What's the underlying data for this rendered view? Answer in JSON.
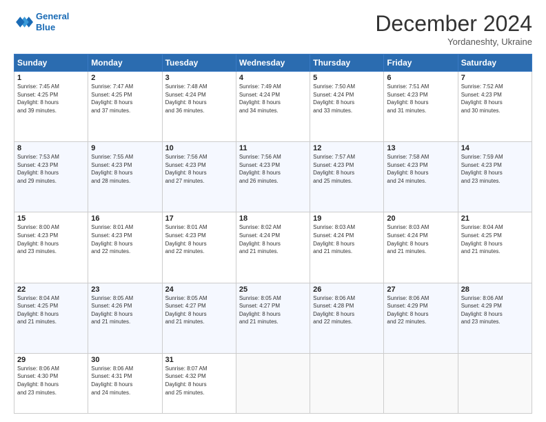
{
  "header": {
    "logo_line1": "General",
    "logo_line2": "Blue",
    "month_title": "December 2024",
    "location": "Yordaneshty, Ukraine"
  },
  "weekdays": [
    "Sunday",
    "Monday",
    "Tuesday",
    "Wednesday",
    "Thursday",
    "Friday",
    "Saturday"
  ],
  "weeks": [
    [
      {
        "day": "1",
        "lines": [
          "Sunrise: 7:45 AM",
          "Sunset: 4:25 PM",
          "Daylight: 8 hours",
          "and 39 minutes."
        ]
      },
      {
        "day": "2",
        "lines": [
          "Sunrise: 7:47 AM",
          "Sunset: 4:25 PM",
          "Daylight: 8 hours",
          "and 37 minutes."
        ]
      },
      {
        "day": "3",
        "lines": [
          "Sunrise: 7:48 AM",
          "Sunset: 4:24 PM",
          "Daylight: 8 hours",
          "and 36 minutes."
        ]
      },
      {
        "day": "4",
        "lines": [
          "Sunrise: 7:49 AM",
          "Sunset: 4:24 PM",
          "Daylight: 8 hours",
          "and 34 minutes."
        ]
      },
      {
        "day": "5",
        "lines": [
          "Sunrise: 7:50 AM",
          "Sunset: 4:24 PM",
          "Daylight: 8 hours",
          "and 33 minutes."
        ]
      },
      {
        "day": "6",
        "lines": [
          "Sunrise: 7:51 AM",
          "Sunset: 4:23 PM",
          "Daylight: 8 hours",
          "and 31 minutes."
        ]
      },
      {
        "day": "7",
        "lines": [
          "Sunrise: 7:52 AM",
          "Sunset: 4:23 PM",
          "Daylight: 8 hours",
          "and 30 minutes."
        ]
      }
    ],
    [
      {
        "day": "8",
        "lines": [
          "Sunrise: 7:53 AM",
          "Sunset: 4:23 PM",
          "Daylight: 8 hours",
          "and 29 minutes."
        ]
      },
      {
        "day": "9",
        "lines": [
          "Sunrise: 7:55 AM",
          "Sunset: 4:23 PM",
          "Daylight: 8 hours",
          "and 28 minutes."
        ]
      },
      {
        "day": "10",
        "lines": [
          "Sunrise: 7:56 AM",
          "Sunset: 4:23 PM",
          "Daylight: 8 hours",
          "and 27 minutes."
        ]
      },
      {
        "day": "11",
        "lines": [
          "Sunrise: 7:56 AM",
          "Sunset: 4:23 PM",
          "Daylight: 8 hours",
          "and 26 minutes."
        ]
      },
      {
        "day": "12",
        "lines": [
          "Sunrise: 7:57 AM",
          "Sunset: 4:23 PM",
          "Daylight: 8 hours",
          "and 25 minutes."
        ]
      },
      {
        "day": "13",
        "lines": [
          "Sunrise: 7:58 AM",
          "Sunset: 4:23 PM",
          "Daylight: 8 hours",
          "and 24 minutes."
        ]
      },
      {
        "day": "14",
        "lines": [
          "Sunrise: 7:59 AM",
          "Sunset: 4:23 PM",
          "Daylight: 8 hours",
          "and 23 minutes."
        ]
      }
    ],
    [
      {
        "day": "15",
        "lines": [
          "Sunrise: 8:00 AM",
          "Sunset: 4:23 PM",
          "Daylight: 8 hours",
          "and 23 minutes."
        ]
      },
      {
        "day": "16",
        "lines": [
          "Sunrise: 8:01 AM",
          "Sunset: 4:23 PM",
          "Daylight: 8 hours",
          "and 22 minutes."
        ]
      },
      {
        "day": "17",
        "lines": [
          "Sunrise: 8:01 AM",
          "Sunset: 4:23 PM",
          "Daylight: 8 hours",
          "and 22 minutes."
        ]
      },
      {
        "day": "18",
        "lines": [
          "Sunrise: 8:02 AM",
          "Sunset: 4:24 PM",
          "Daylight: 8 hours",
          "and 21 minutes."
        ]
      },
      {
        "day": "19",
        "lines": [
          "Sunrise: 8:03 AM",
          "Sunset: 4:24 PM",
          "Daylight: 8 hours",
          "and 21 minutes."
        ]
      },
      {
        "day": "20",
        "lines": [
          "Sunrise: 8:03 AM",
          "Sunset: 4:24 PM",
          "Daylight: 8 hours",
          "and 21 minutes."
        ]
      },
      {
        "day": "21",
        "lines": [
          "Sunrise: 8:04 AM",
          "Sunset: 4:25 PM",
          "Daylight: 8 hours",
          "and 21 minutes."
        ]
      }
    ],
    [
      {
        "day": "22",
        "lines": [
          "Sunrise: 8:04 AM",
          "Sunset: 4:25 PM",
          "Daylight: 8 hours",
          "and 21 minutes."
        ]
      },
      {
        "day": "23",
        "lines": [
          "Sunrise: 8:05 AM",
          "Sunset: 4:26 PM",
          "Daylight: 8 hours",
          "and 21 minutes."
        ]
      },
      {
        "day": "24",
        "lines": [
          "Sunrise: 8:05 AM",
          "Sunset: 4:27 PM",
          "Daylight: 8 hours",
          "and 21 minutes."
        ]
      },
      {
        "day": "25",
        "lines": [
          "Sunrise: 8:05 AM",
          "Sunset: 4:27 PM",
          "Daylight: 8 hours",
          "and 21 minutes."
        ]
      },
      {
        "day": "26",
        "lines": [
          "Sunrise: 8:06 AM",
          "Sunset: 4:28 PM",
          "Daylight: 8 hours",
          "and 22 minutes."
        ]
      },
      {
        "day": "27",
        "lines": [
          "Sunrise: 8:06 AM",
          "Sunset: 4:29 PM",
          "Daylight: 8 hours",
          "and 22 minutes."
        ]
      },
      {
        "day": "28",
        "lines": [
          "Sunrise: 8:06 AM",
          "Sunset: 4:29 PM",
          "Daylight: 8 hours",
          "and 23 minutes."
        ]
      }
    ],
    [
      {
        "day": "29",
        "lines": [
          "Sunrise: 8:06 AM",
          "Sunset: 4:30 PM",
          "Daylight: 8 hours",
          "and 23 minutes."
        ]
      },
      {
        "day": "30",
        "lines": [
          "Sunrise: 8:06 AM",
          "Sunset: 4:31 PM",
          "Daylight: 8 hours",
          "and 24 minutes."
        ]
      },
      {
        "day": "31",
        "lines": [
          "Sunrise: 8:07 AM",
          "Sunset: 4:32 PM",
          "Daylight: 8 hours",
          "and 25 minutes."
        ]
      },
      null,
      null,
      null,
      null
    ]
  ]
}
